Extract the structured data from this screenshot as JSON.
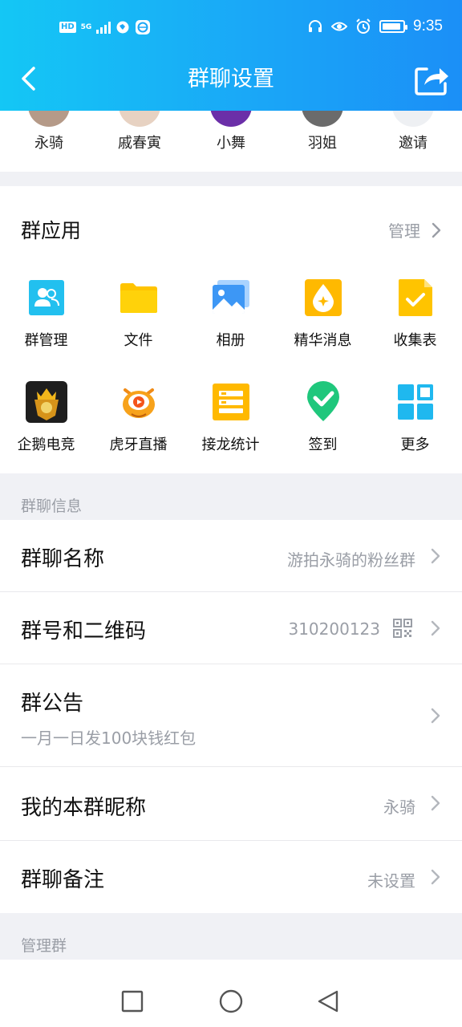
{
  "status_bar": {
    "hd": "HD",
    "network": "5G",
    "time": "9:35",
    "battery_level": 0.9
  },
  "header": {
    "title": "群聊设置"
  },
  "members": [
    {
      "name": "永骑",
      "avatar_color": "#b59a88"
    },
    {
      "name": "戚春寅",
      "avatar_color": "#e7d2c2"
    },
    {
      "name": "小舞",
      "avatar_color": "#6b2fa8"
    },
    {
      "name": "羽姐",
      "avatar_color": "#6b6b6b"
    },
    {
      "name": "邀请",
      "avatar_color": "#eef0f3"
    }
  ],
  "group_apps": {
    "title": "群应用",
    "manage_label": "管理",
    "items": [
      {
        "label": "群管理",
        "icon": "group-manage-icon"
      },
      {
        "label": "文件",
        "icon": "folder-icon"
      },
      {
        "label": "相册",
        "icon": "album-icon"
      },
      {
        "label": "精华消息",
        "icon": "essence-icon"
      },
      {
        "label": "收集表",
        "icon": "collect-form-icon"
      },
      {
        "label": "企鹅电竞",
        "icon": "esports-icon"
      },
      {
        "label": "虎牙直播",
        "icon": "huya-icon"
      },
      {
        "label": "接龙统计",
        "icon": "relay-icon"
      },
      {
        "label": "签到",
        "icon": "checkin-icon"
      },
      {
        "label": "更多",
        "icon": "more-grid-icon"
      }
    ]
  },
  "group_info": {
    "section_title": "群聊信息",
    "name_label": "群聊名称",
    "name_value": "游拍永骑的粉丝群",
    "id_label": "群号和二维码",
    "id_value": "310200123",
    "notice_label": "群公告",
    "notice_value": "一月一日发100块钱红包",
    "nickname_label": "我的本群昵称",
    "nickname_value": "永骑",
    "remark_label": "群聊备注",
    "remark_value": "未设置"
  },
  "manage_section": {
    "title": "管理群"
  },
  "colors": {
    "header_start": "#14c7f5",
    "header_end": "#1b8ff7",
    "secondary_text": "#9a9ea6",
    "background": "#f0f1f5"
  }
}
